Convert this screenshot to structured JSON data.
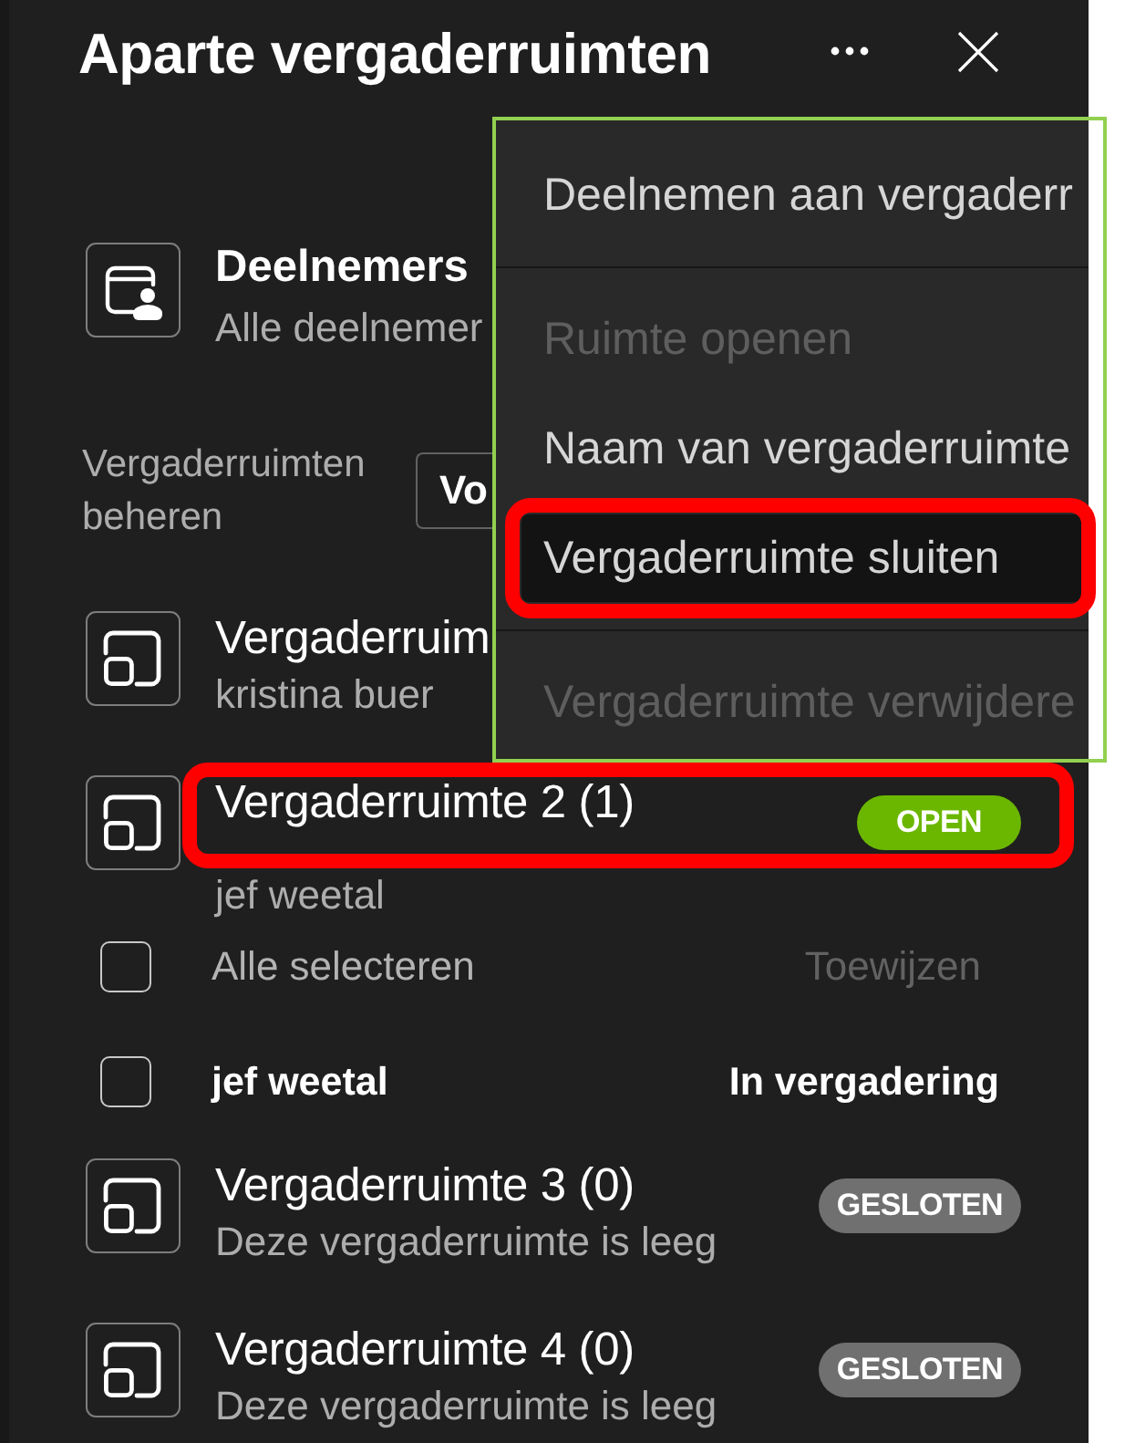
{
  "panel": {
    "title": "Aparte vergaderruimten"
  },
  "participants": {
    "title": "Deelnemers",
    "subtitle": "Alle deelnemer"
  },
  "manage": {
    "label": "Vergaderruimten beheren",
    "button": "Vo"
  },
  "list": [
    {
      "kind": "room",
      "title": "Vergaderruim",
      "subtitle": "kristina buer",
      "marked": false
    },
    {
      "kind": "room",
      "title": "Vergaderruimte 2 (1)",
      "subtitle": "jef weetal",
      "badge": {
        "label": "OPEN",
        "kind": "open"
      },
      "marked": true
    },
    {
      "kind": "select-all",
      "label": "Alle selecteren",
      "checked": false,
      "action": {
        "label": "Toewijzen",
        "disabled": true
      }
    },
    {
      "kind": "participant",
      "name": "jef weetal",
      "status": "In vergadering",
      "checked": false
    },
    {
      "kind": "room",
      "title": "Vergaderruimte 3 (0)",
      "subtitle": "Deze vergaderruimte is leeg",
      "badge": {
        "label": "GESLOTEN",
        "kind": "closed"
      },
      "marked": false
    },
    {
      "kind": "room",
      "title": "Vergaderruimte 4 (0)",
      "subtitle": "Deze vergaderruimte is leeg",
      "badge": {
        "label": "GESLOTEN",
        "kind": "closed"
      },
      "marked": false
    }
  ],
  "menu": {
    "framed": true,
    "items": [
      {
        "kind": "item",
        "label": "Deelnemen aan vergaderr",
        "disabled": false,
        "hovered": false,
        "marked": false
      },
      {
        "kind": "divider"
      },
      {
        "kind": "item",
        "label": "Ruimte openen",
        "disabled": true,
        "hovered": false,
        "marked": false
      },
      {
        "kind": "item",
        "label": "Naam van vergaderruimte",
        "disabled": false,
        "hovered": false,
        "marked": false
      },
      {
        "kind": "item",
        "label": "Vergaderruimte sluiten",
        "disabled": false,
        "hovered": true,
        "marked": true
      },
      {
        "kind": "divider"
      },
      {
        "kind": "item",
        "label": "Vergaderruimte verwijdere",
        "disabled": true,
        "hovered": false,
        "marked": false
      }
    ]
  }
}
